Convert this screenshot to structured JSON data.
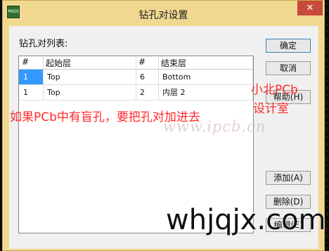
{
  "window": {
    "title": "钻孔对设置",
    "app_icon_text": "PADS",
    "close_symbol": "✕"
  },
  "list": {
    "label": "钻孔对列表:",
    "columns": [
      "#",
      "起始层",
      "#",
      "结束层"
    ],
    "rows": [
      [
        "1",
        "Top",
        "6",
        "Bottom"
      ],
      [
        "1",
        "Top",
        "2",
        "内层 2"
      ]
    ]
  },
  "buttons": {
    "ok": "确定",
    "cancel": "取消",
    "help": "帮助(H)",
    "add": "添加(A)",
    "delete": "删除(D)",
    "edit": "编辑(E)"
  },
  "overlays": {
    "annotation_main": "如果PCb中有盲孔，要把孔对加进去",
    "annotation_side_line1": "小北PCb",
    "annotation_side_line2": "设计室",
    "watermark_site": "www.ipcb.cn",
    "watermark_big": "whjqjx.com"
  },
  "colors": {
    "annotation": "#ff2a2a",
    "selection": "#3399ff",
    "close_button": "#c74a3a"
  }
}
